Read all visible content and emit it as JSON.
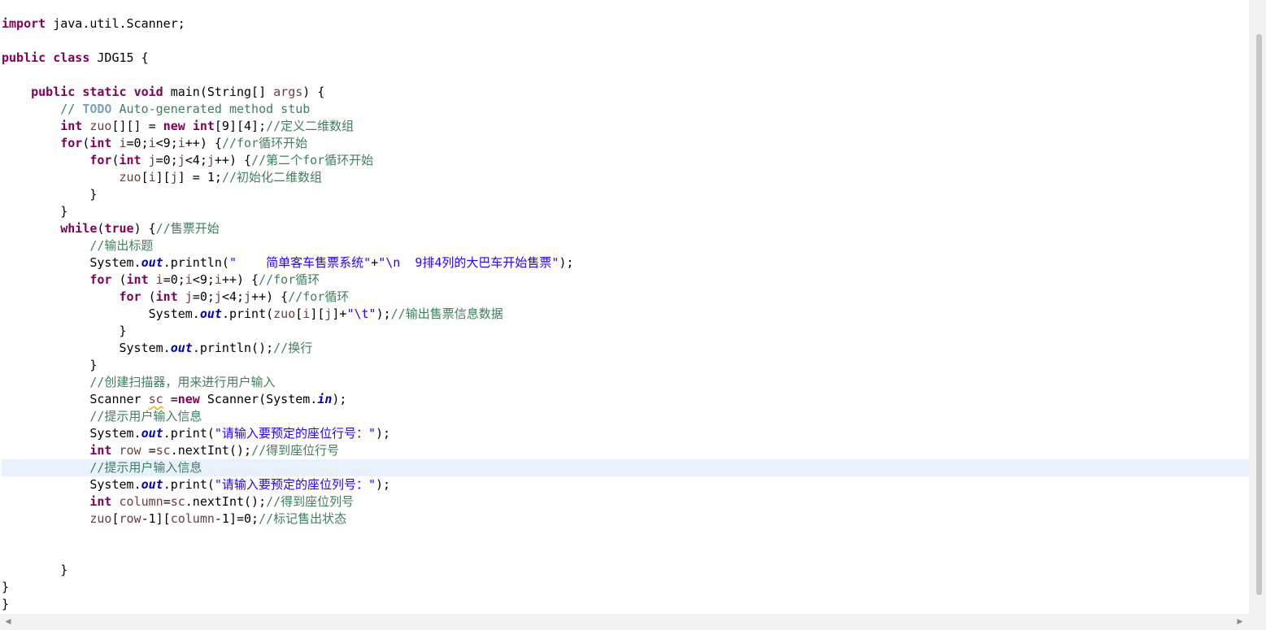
{
  "editor": {
    "lines": [
      [
        {
          "t": "import",
          "c": "kw"
        },
        {
          "t": " java.util.Scanner;"
        }
      ],
      [],
      [
        {
          "t": "public",
          "c": "kw"
        },
        {
          "t": " "
        },
        {
          "t": "class",
          "c": "kw"
        },
        {
          "t": " JDG15 {"
        }
      ],
      [],
      [
        {
          "t": "    "
        },
        {
          "t": "public",
          "c": "kw"
        },
        {
          "t": " "
        },
        {
          "t": "static",
          "c": "kw"
        },
        {
          "t": " "
        },
        {
          "t": "void",
          "c": "kw"
        },
        {
          "t": " main(String[] "
        },
        {
          "t": "args",
          "c": "vr"
        },
        {
          "t": ") {"
        }
      ],
      [
        {
          "t": "        "
        },
        {
          "t": "// ",
          "c": "cm"
        },
        {
          "t": "TODO",
          "c": "todo"
        },
        {
          "t": " Auto-generated method stub",
          "c": "cm"
        }
      ],
      [
        {
          "t": "        "
        },
        {
          "t": "int",
          "c": "kw"
        },
        {
          "t": " "
        },
        {
          "t": "zuo",
          "c": "vr"
        },
        {
          "t": "[][] = "
        },
        {
          "t": "new",
          "c": "kw"
        },
        {
          "t": " "
        },
        {
          "t": "int",
          "c": "kw"
        },
        {
          "t": "[9][4];"
        },
        {
          "t": "//定义二维数组",
          "c": "cm"
        }
      ],
      [
        {
          "t": "        "
        },
        {
          "t": "for",
          "c": "kw"
        },
        {
          "t": "("
        },
        {
          "t": "int",
          "c": "kw"
        },
        {
          "t": " "
        },
        {
          "t": "i",
          "c": "vr"
        },
        {
          "t": "=0;"
        },
        {
          "t": "i",
          "c": "vr"
        },
        {
          "t": "<9;"
        },
        {
          "t": "i",
          "c": "vr"
        },
        {
          "t": "++) {"
        },
        {
          "t": "//for循环开始",
          "c": "cm"
        }
      ],
      [
        {
          "t": "            "
        },
        {
          "t": "for",
          "c": "kw"
        },
        {
          "t": "("
        },
        {
          "t": "int",
          "c": "kw"
        },
        {
          "t": " "
        },
        {
          "t": "j",
          "c": "vr"
        },
        {
          "t": "=0;"
        },
        {
          "t": "j",
          "c": "vr"
        },
        {
          "t": "<4;"
        },
        {
          "t": "j",
          "c": "vr"
        },
        {
          "t": "++) {"
        },
        {
          "t": "//第二个for循环开始",
          "c": "cm"
        }
      ],
      [
        {
          "t": "                "
        },
        {
          "t": "zuo",
          "c": "vr"
        },
        {
          "t": "["
        },
        {
          "t": "i",
          "c": "vr"
        },
        {
          "t": "]["
        },
        {
          "t": "j",
          "c": "vr"
        },
        {
          "t": "] = 1;"
        },
        {
          "t": "//初始化二维数组",
          "c": "cm"
        }
      ],
      [
        {
          "t": "            }"
        }
      ],
      [
        {
          "t": "        }"
        }
      ],
      [
        {
          "t": "        "
        },
        {
          "t": "while",
          "c": "kw"
        },
        {
          "t": "("
        },
        {
          "t": "true",
          "c": "kw"
        },
        {
          "t": ") {"
        },
        {
          "t": "//售票开始",
          "c": "cm"
        }
      ],
      [
        {
          "t": "            "
        },
        {
          "t": "//输出标题",
          "c": "cm"
        }
      ],
      [
        {
          "t": "            System."
        },
        {
          "t": "out",
          "c": "fd"
        },
        {
          "t": ".println("
        },
        {
          "t": "\"    简单客车售票系统\"",
          "c": "st"
        },
        {
          "t": "+"
        },
        {
          "t": "\"\\n  9排4列的大巴车开始售票\"",
          "c": "st"
        },
        {
          "t": ");"
        }
      ],
      [
        {
          "t": "            "
        },
        {
          "t": "for",
          "c": "kw"
        },
        {
          "t": " ("
        },
        {
          "t": "int",
          "c": "kw"
        },
        {
          "t": " "
        },
        {
          "t": "i",
          "c": "vr"
        },
        {
          "t": "=0;"
        },
        {
          "t": "i",
          "c": "vr"
        },
        {
          "t": "<9;"
        },
        {
          "t": "i",
          "c": "vr"
        },
        {
          "t": "++) {"
        },
        {
          "t": "//for循环",
          "c": "cm"
        }
      ],
      [
        {
          "t": "                "
        },
        {
          "t": "for",
          "c": "kw"
        },
        {
          "t": " ("
        },
        {
          "t": "int",
          "c": "kw"
        },
        {
          "t": " "
        },
        {
          "t": "j",
          "c": "vr"
        },
        {
          "t": "=0;"
        },
        {
          "t": "j",
          "c": "vr"
        },
        {
          "t": "<4;"
        },
        {
          "t": "j",
          "c": "vr"
        },
        {
          "t": "++) {"
        },
        {
          "t": "//for循环",
          "c": "cm"
        }
      ],
      [
        {
          "t": "                    System."
        },
        {
          "t": "out",
          "c": "fd"
        },
        {
          "t": ".print("
        },
        {
          "t": "zuo",
          "c": "vr"
        },
        {
          "t": "["
        },
        {
          "t": "i",
          "c": "vr"
        },
        {
          "t": "]["
        },
        {
          "t": "j",
          "c": "vr"
        },
        {
          "t": "]+"
        },
        {
          "t": "\"\\t\"",
          "c": "st"
        },
        {
          "t": ");"
        },
        {
          "t": "//输出售票信息数据",
          "c": "cm"
        }
      ],
      [
        {
          "t": "                }"
        }
      ],
      [
        {
          "t": "                System."
        },
        {
          "t": "out",
          "c": "fd"
        },
        {
          "t": ".println();"
        },
        {
          "t": "//换行",
          "c": "cm"
        }
      ],
      [
        {
          "t": "            }"
        }
      ],
      [
        {
          "t": "            "
        },
        {
          "t": "//创建扫描器，用来进行用户输入",
          "c": "cm"
        }
      ],
      [
        {
          "t": "            Scanner "
        },
        {
          "t": "sc",
          "c": "vr warn"
        },
        {
          "t": " ="
        },
        {
          "t": "new",
          "c": "kw"
        },
        {
          "t": " Scanner(System."
        },
        {
          "t": "in",
          "c": "fd"
        },
        {
          "t": ");"
        }
      ],
      [
        {
          "t": "            "
        },
        {
          "t": "//提示用户输入信息",
          "c": "cm"
        }
      ],
      [
        {
          "t": "            System."
        },
        {
          "t": "out",
          "c": "fd"
        },
        {
          "t": ".print("
        },
        {
          "t": "\"请输入要预定的座位行号：\"",
          "c": "st"
        },
        {
          "t": ");"
        }
      ],
      [
        {
          "t": "            "
        },
        {
          "t": "int",
          "c": "kw"
        },
        {
          "t": " "
        },
        {
          "t": "row",
          "c": "vr"
        },
        {
          "t": " ="
        },
        {
          "t": "sc",
          "c": "vr"
        },
        {
          "t": ".nextInt();"
        },
        {
          "t": "//得到座位行号",
          "c": "cm"
        }
      ],
      [
        {
          "t": "            "
        },
        {
          "t": "//提示用户输入信息",
          "c": "cm"
        }
      ],
      [
        {
          "t": "            System."
        },
        {
          "t": "out",
          "c": "fd"
        },
        {
          "t": ".print("
        },
        {
          "t": "\"请输入要预定的座位列号：\"",
          "c": "st"
        },
        {
          "t": ");"
        }
      ],
      [
        {
          "t": "            "
        },
        {
          "t": "int",
          "c": "kw"
        },
        {
          "t": " "
        },
        {
          "t": "column",
          "c": "vr"
        },
        {
          "t": "="
        },
        {
          "t": "sc",
          "c": "vr"
        },
        {
          "t": ".nextInt();"
        },
        {
          "t": "//得到座位列号",
          "c": "cm"
        }
      ],
      [
        {
          "t": "            "
        },
        {
          "t": "zuo",
          "c": "vr"
        },
        {
          "t": "["
        },
        {
          "t": "row",
          "c": "vr"
        },
        {
          "t": "-1]["
        },
        {
          "t": "column",
          "c": "vr"
        },
        {
          "t": "-1]=0;"
        },
        {
          "t": "//标记售出状态",
          "c": "cm"
        }
      ],
      [],
      [],
      [
        {
          "t": "        }"
        }
      ],
      [
        {
          "t": "}"
        }
      ],
      [
        {
          "t": "}"
        }
      ]
    ],
    "current_line_index": 26
  },
  "scrollbars": {
    "left_arrow": "◀",
    "right_arrow": "▶"
  },
  "colors": {
    "keyword": "#7f0055",
    "comment": "#3f7f5f",
    "string": "#2a00ff",
    "static_field": "#0000c0",
    "local_variable": "#6a3e3e",
    "todo_tag": "#7f9fbf",
    "current_line": "#e8f2fe"
  }
}
